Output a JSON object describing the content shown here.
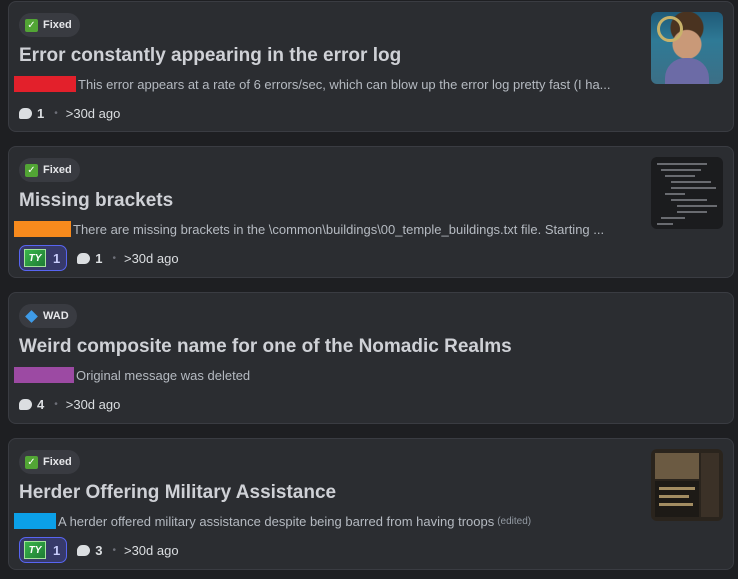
{
  "threads": [
    {
      "tag": {
        "label": "Fixed",
        "icon": "check-icon"
      },
      "title": "Error constantly appearing in the error log",
      "author_color": "#e3202b",
      "preview": "This error appears at a rate of 6 errors/sec, which can blow up the error log pretty fast (I ha...",
      "edited": "",
      "reactions": null,
      "replies": "1",
      "time": ">30d ago",
      "thumbnail": "portrait"
    },
    {
      "tag": {
        "label": "Fixed",
        "icon": "check-icon"
      },
      "title": "Missing brackets",
      "author_color": "#f78a1d",
      "preview": "There are missing brackets in the \\common\\buildings\\00_temple_buildings.txt file. Starting ...",
      "edited": "",
      "reactions": {
        "emoji": "TY",
        "count": "1"
      },
      "replies": "1",
      "time": ">30d ago",
      "thumbnail": "code"
    },
    {
      "tag": {
        "label": "WAD",
        "icon": "diamond-icon"
      },
      "title": "Weird composite name for one of the Nomadic Realms",
      "author_color": "#9c4aa3",
      "preview": "Original message was deleted",
      "edited": "",
      "reactions": null,
      "replies": "4",
      "time": ">30d ago",
      "thumbnail": null
    },
    {
      "tag": {
        "label": "Fixed",
        "icon": "check-icon"
      },
      "title": "Herder Offering Military Assistance",
      "author_color": "#0ba0e8",
      "preview": "A herder offered military assistance despite being barred from having troops",
      "edited": "(edited)",
      "reactions": {
        "emoji": "TY",
        "count": "1"
      },
      "replies": "3",
      "time": ">30d ago",
      "thumbnail": "game"
    }
  ]
}
